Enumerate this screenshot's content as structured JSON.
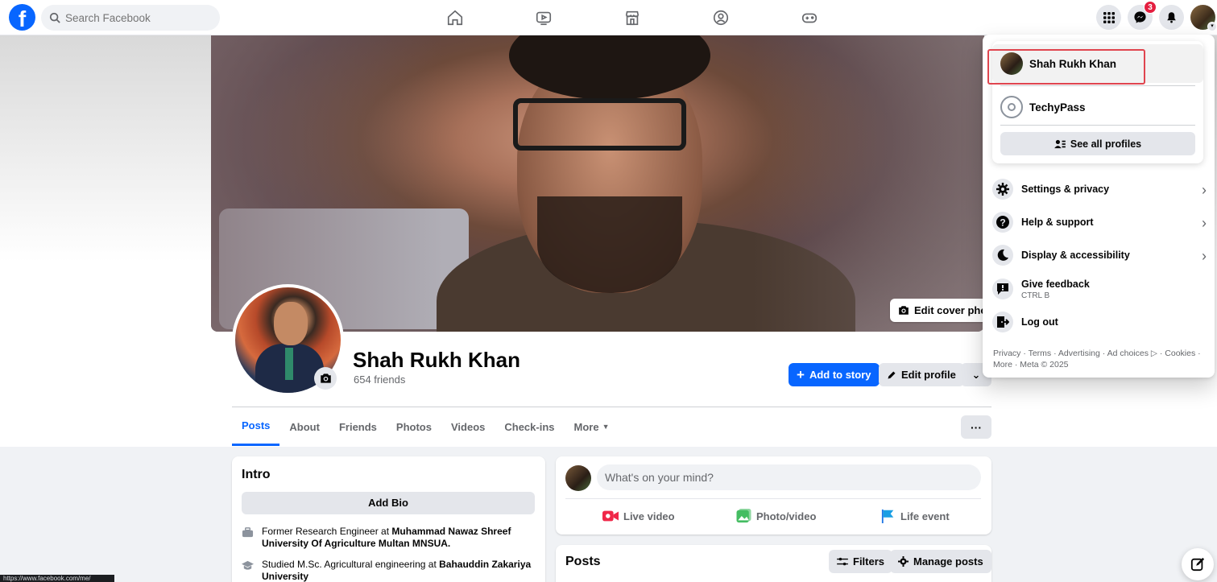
{
  "topbar": {
    "logo_letter": "f",
    "search_placeholder": "Search Facebook",
    "nav_icons": [
      "home-icon",
      "video-icon",
      "marketplace-icon",
      "groups-icon",
      "gaming-icon"
    ],
    "messenger_badge": "3"
  },
  "cover": {
    "edit_cover_label": "Edit cover photo"
  },
  "profile": {
    "name": "Shah Rukh Khan",
    "friends": "654 friends",
    "add_story_label": "Add to story",
    "edit_profile_label": "Edit profile"
  },
  "tabs": [
    "Posts",
    "About",
    "Friends",
    "Photos",
    "Videos",
    "Check-ins",
    "More"
  ],
  "intro": {
    "title": "Intro",
    "add_bio": "Add Bio",
    "work_prefix": "Former Research Engineer at ",
    "work_place": "Muhammad Nawaz Shreef University Of Agriculture Multan MNSUA.",
    "study_prefix": "Studied M.Sc. Agricultural engineering at ",
    "study_place": "Bahauddin Zakariya University"
  },
  "composer": {
    "placeholder": "What's on your mind?",
    "live_video": "Live video",
    "photo_video": "Photo/video",
    "life_event": "Life event"
  },
  "posts": {
    "title": "Posts",
    "filters": "Filters",
    "manage": "Manage posts"
  },
  "menu": {
    "profile_name": "Shah Rukh Khan",
    "page_name": "TechyPass",
    "see_all": "See all profiles",
    "items": [
      {
        "label": "Settings & privacy",
        "icon": "gear-icon"
      },
      {
        "label": "Help & support",
        "icon": "question-icon"
      },
      {
        "label": "Display & accessibility",
        "icon": "moon-icon"
      },
      {
        "label": "Give feedback",
        "sub": "CTRL B",
        "icon": "feedback-icon"
      },
      {
        "label": "Log out",
        "icon": "logout-icon"
      }
    ],
    "footer_line1": "Privacy · Terms · Advertising · Ad choices ▷ · Cookies ·",
    "footer_line2": "More · Meta © 2025"
  },
  "status_url": "https://www.facebook.com/me/",
  "colors": {
    "brand": "#0866ff",
    "highlight_box": "#e0454f",
    "badge": "#e41e3f"
  }
}
